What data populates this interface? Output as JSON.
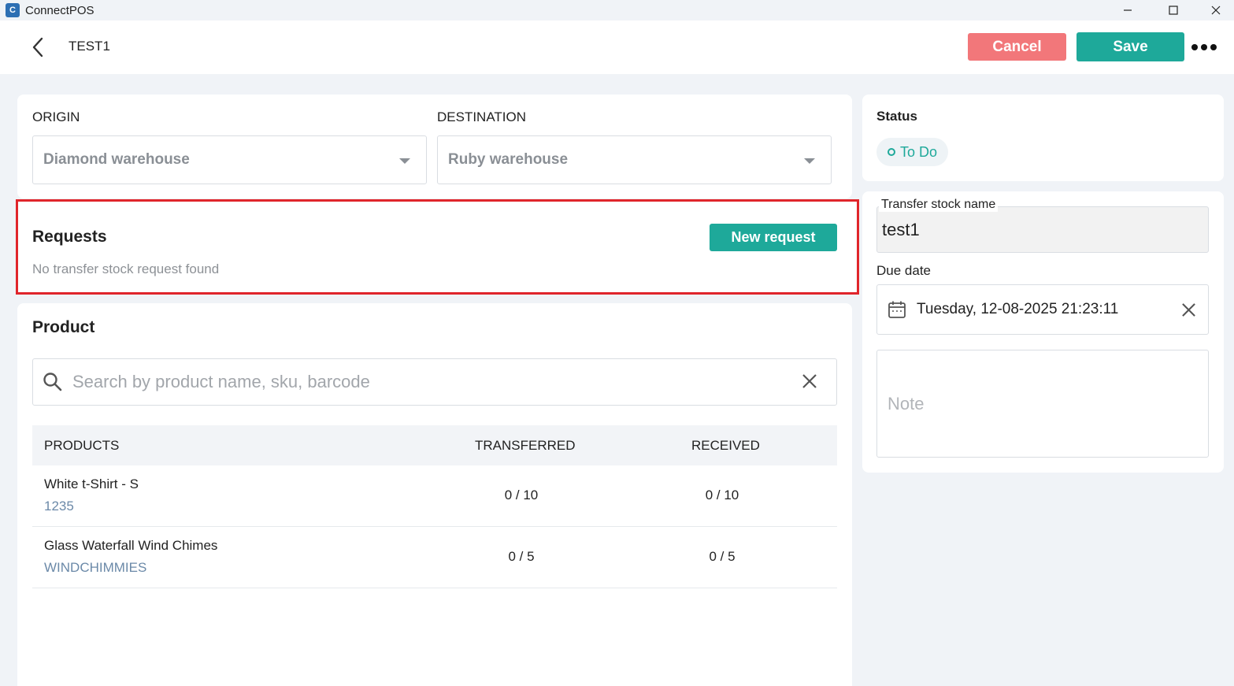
{
  "window": {
    "app_title": "ConnectPOS",
    "logo_letter": "C"
  },
  "header": {
    "title": "TEST1",
    "cancel_label": "Cancel",
    "save_label": "Save"
  },
  "route": {
    "origin_label": "ORIGIN",
    "origin_value": "Diamond warehouse",
    "destination_label": "DESTINATION",
    "destination_value": "Ruby warehouse"
  },
  "requests": {
    "title": "Requests",
    "new_request_label": "New request",
    "empty_text": "No transfer stock request found"
  },
  "product": {
    "title": "Product",
    "search_placeholder": "Search by product name, sku, barcode",
    "columns": [
      "PRODUCTS",
      "TRANSFERRED",
      "RECEIVED"
    ],
    "rows": [
      {
        "name": "White t-Shirt - S",
        "sku": "1235",
        "transferred": "0 / 10",
        "received": "0 / 10"
      },
      {
        "name": "Glass Waterfall Wind Chimes",
        "sku": "WINDCHIMMIES",
        "transferred": "0 / 5",
        "received": "0 / 5"
      }
    ]
  },
  "side": {
    "status_label": "Status",
    "status_value": "To Do",
    "transfer_name_label": "Transfer stock name",
    "transfer_name_value": "test1",
    "due_date_label": "Due date",
    "due_date_value": "Tuesday, 12-08-2025 21:23:11",
    "note_placeholder": "Note"
  },
  "colors": {
    "accent": "#1ea99a",
    "cancel": "#f2777a",
    "highlight_border": "#e0252b"
  }
}
